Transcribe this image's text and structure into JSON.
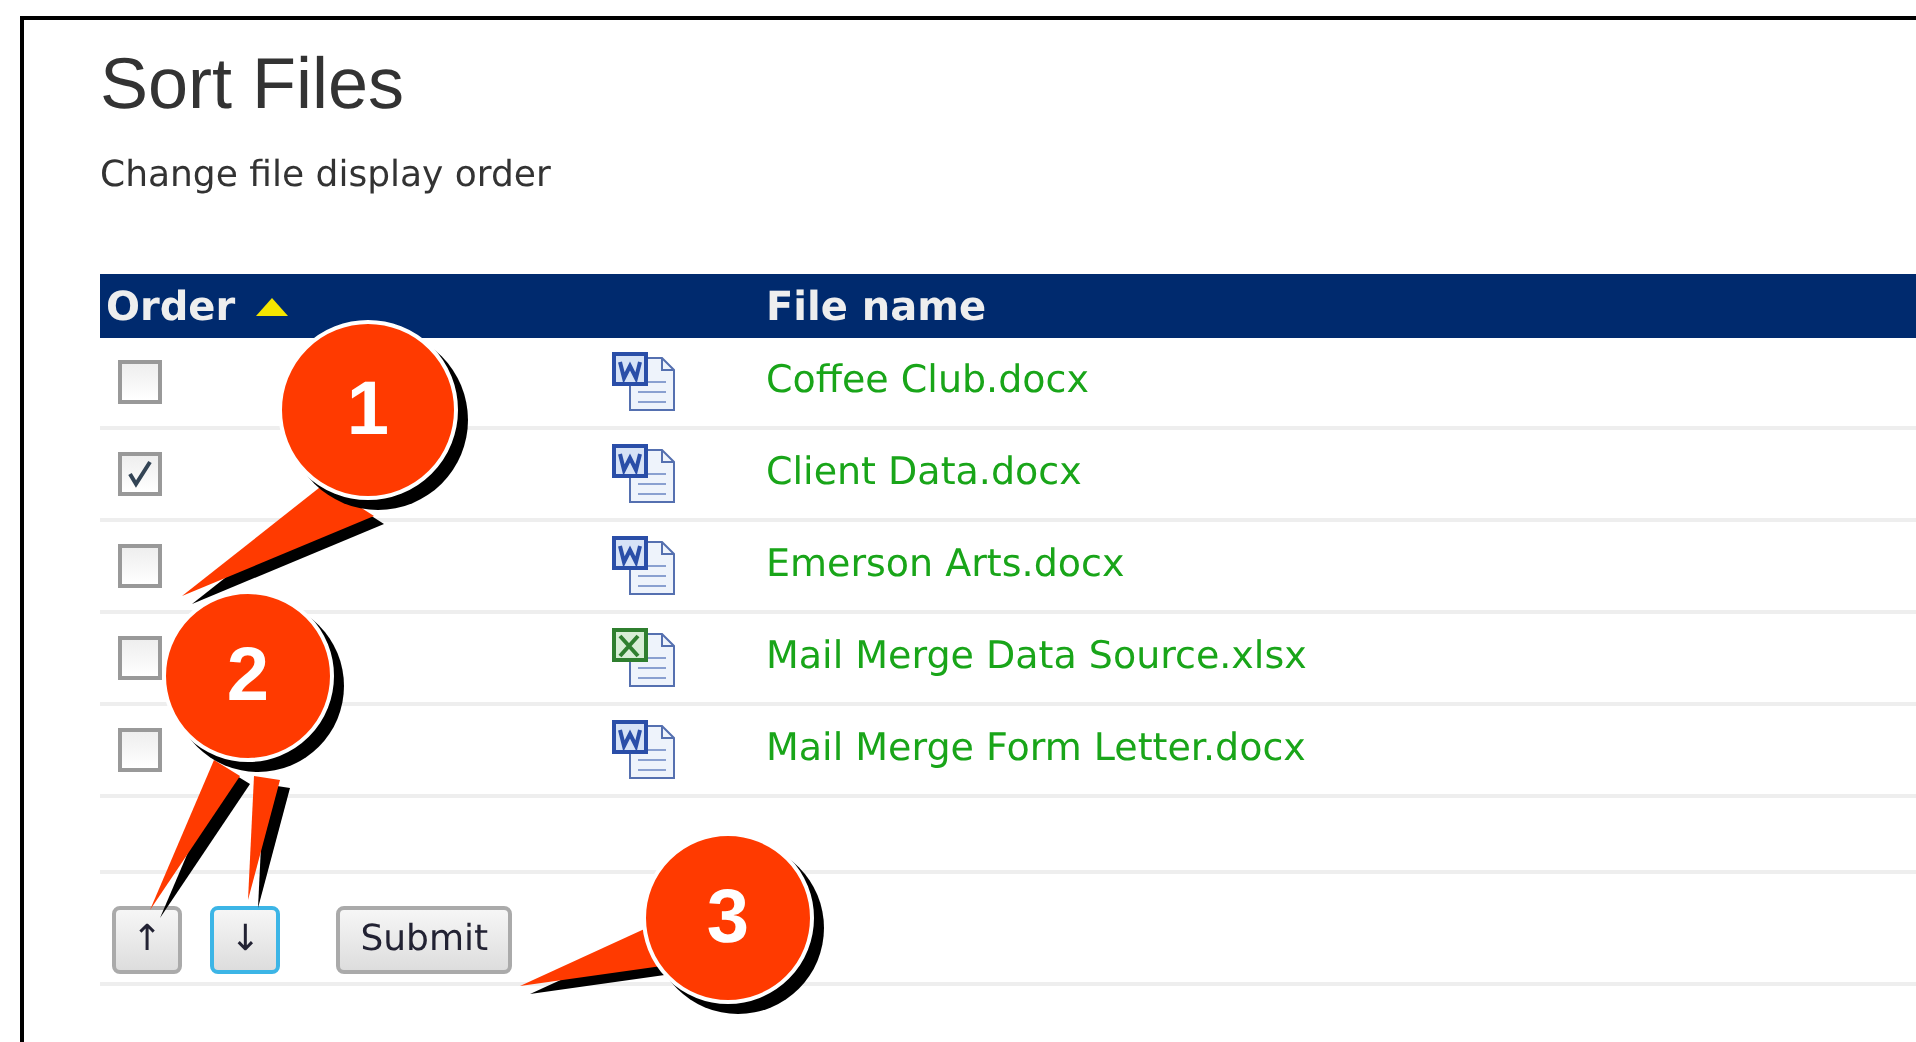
{
  "title": "Sort Files",
  "subtitle": "Change file display order",
  "columns": [
    {
      "label": "Order",
      "sorted": true
    },
    {
      "label": "File name"
    }
  ],
  "rows": [
    {
      "checked": false,
      "kind": "word",
      "name": "Coffee Club.docx"
    },
    {
      "checked": true,
      "kind": "word",
      "name": "Client Data.docx"
    },
    {
      "checked": false,
      "kind": "word",
      "name": "Emerson Arts.docx"
    },
    {
      "checked": false,
      "kind": "excel",
      "name": "Mail Merge Data Source.xlsx"
    },
    {
      "checked": false,
      "kind": "word",
      "name": "Mail Merge Form Letter.docx"
    }
  ],
  "buttons": [
    {
      "label": "↑",
      "focused": false
    },
    {
      "label": "↓",
      "focused": true
    },
    {
      "label": "Submit",
      "focused": false
    }
  ],
  "callouts": [
    {
      "number": "1"
    },
    {
      "number": "2"
    },
    {
      "number": "3"
    }
  ]
}
